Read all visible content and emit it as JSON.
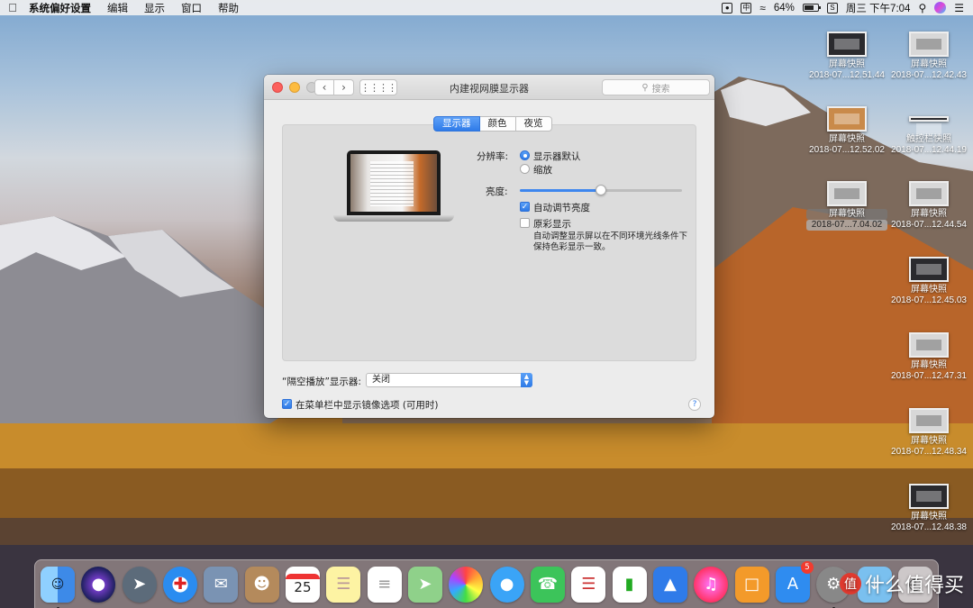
{
  "menubar": {
    "app_name": "系统偏好设置",
    "menus": [
      "编辑",
      "显示",
      "窗口",
      "帮助"
    ],
    "battery_percent": "64%",
    "clock": "周三 下午7:04",
    "input_method": "中"
  },
  "desktop_icons": [
    {
      "name": "屏幕快照",
      "date": "2018-07...12.51.44"
    },
    {
      "name": "屏幕快照",
      "date": "2018-07...12.42.43"
    },
    {
      "name": "屏幕快照",
      "date": "2018-07...12.52.02"
    },
    {
      "name": "触控栏快照",
      "date": "2018-07...12.44.19"
    },
    {
      "name": "屏幕快照",
      "date": "2018-07...7.04.02"
    },
    {
      "name": "屏幕快照",
      "date": "2018-07...12.44.54"
    },
    {
      "name": "屏幕快照",
      "date": "2018-07...12.45.03"
    },
    {
      "name": "屏幕快照",
      "date": "2018-07...12.47.31"
    },
    {
      "name": "屏幕快照",
      "date": "2018-07...12.48.34"
    },
    {
      "name": "屏幕快照",
      "date": "2018-07...12.48.38"
    }
  ],
  "window": {
    "title": "内建视网膜显示器",
    "search_placeholder": "搜索",
    "tabs": [
      {
        "label": "显示器",
        "active": true
      },
      {
        "label": "颜色",
        "active": false
      },
      {
        "label": "夜览",
        "active": false
      }
    ],
    "resolution_label": "分辨率:",
    "resolution_options": [
      {
        "label": "显示器默认",
        "selected": true
      },
      {
        "label": "缩放",
        "selected": false
      }
    ],
    "brightness_label": "亮度:",
    "brightness_level": 0.5,
    "auto_brightness_label": "自动调节亮度",
    "auto_brightness_checked": true,
    "true_tone_label": "原彩显示",
    "true_tone_checked": false,
    "true_tone_desc": "自动调整显示屏以在不同环境光线条件下保持色彩显示一致。",
    "airplay_label": "“隔空播放”显示器:",
    "airplay_value": "关闭",
    "mirroring_label": "在菜单栏中显示镜像选项 (可用时)",
    "mirroring_checked": true,
    "help_symbol": "?"
  },
  "dock": {
    "calendar_day": "25",
    "app_store_badge": "5"
  },
  "watermark": {
    "logo_text": "值",
    "text": "什么值得买"
  },
  "colors": {
    "accent": "#2f7be9",
    "close": "#fc605c",
    "minimize": "#fdbc40"
  }
}
